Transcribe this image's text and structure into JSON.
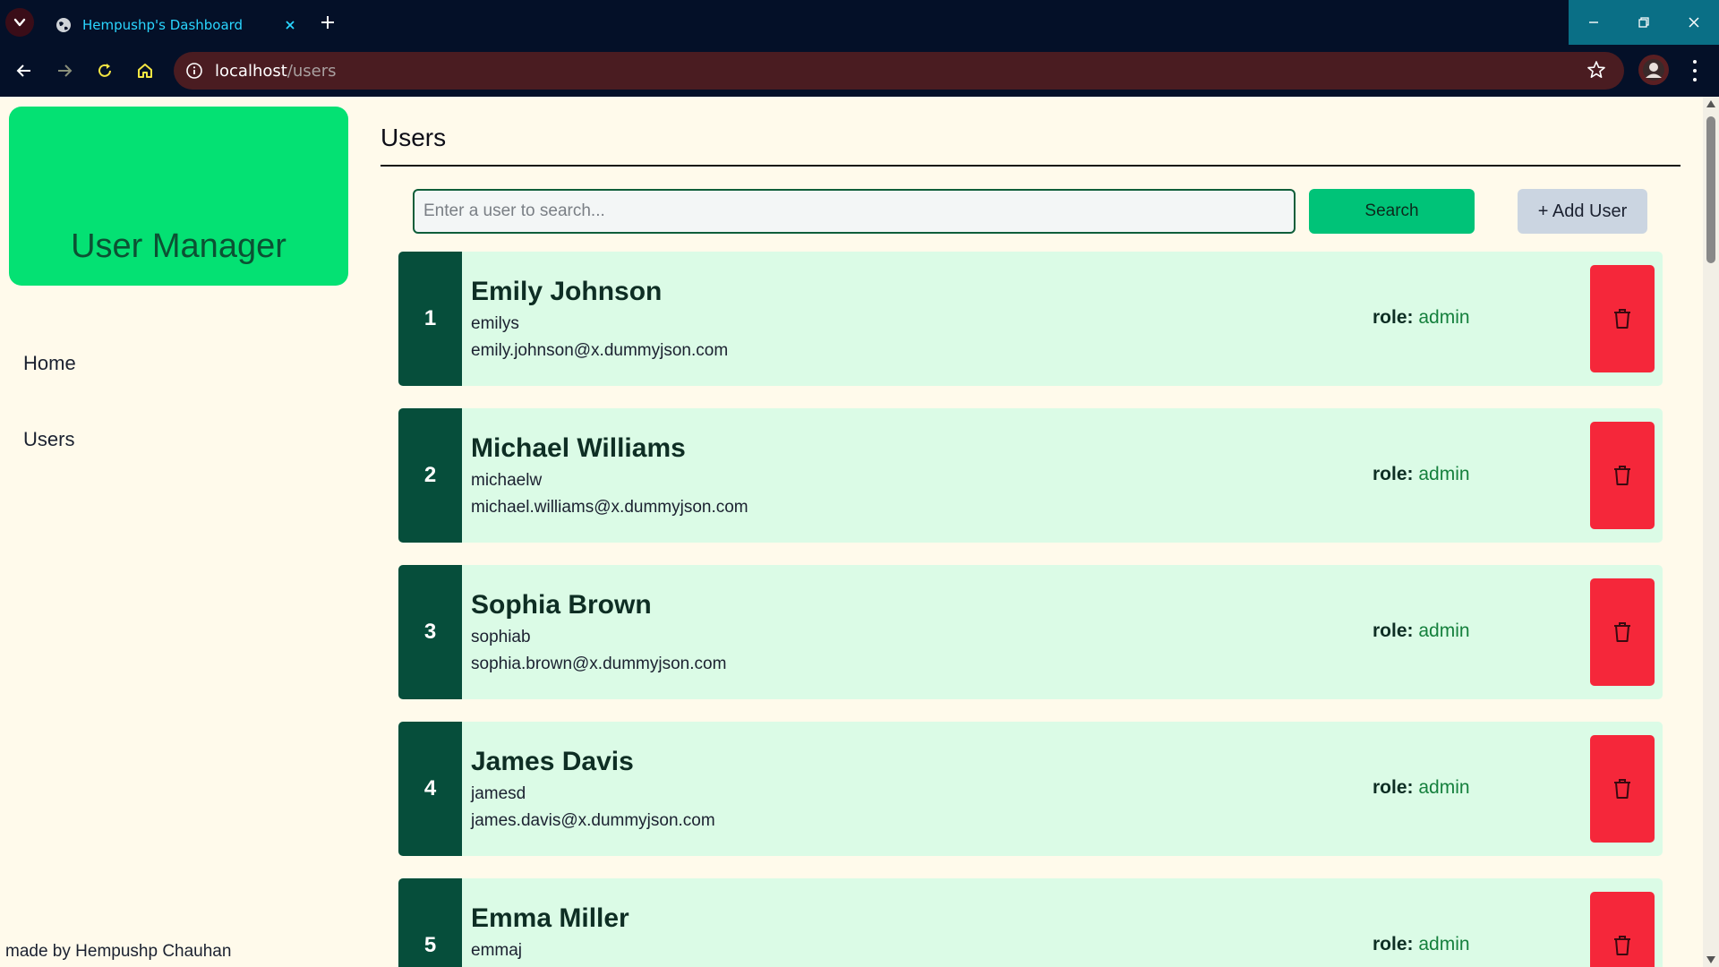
{
  "browser": {
    "tab_title": "Hempushp's Dashboard",
    "url_host": "localhost",
    "url_path": "/users"
  },
  "sidebar": {
    "brand": "User Manager",
    "nav": [
      {
        "label": "Home"
      },
      {
        "label": "Users"
      }
    ],
    "credit": "made by Hempushp Chauhan"
  },
  "main": {
    "title": "Users",
    "search_placeholder": "Enter a user to search...",
    "search_button": "Search",
    "add_button": "+ Add User",
    "role_label": "role:"
  },
  "users": [
    {
      "index": "1",
      "name": "Emily Johnson",
      "username": "emilys",
      "email": "emily.johnson@x.dummyjson.com",
      "role": "admin"
    },
    {
      "index": "2",
      "name": "Michael Williams",
      "username": "michaelw",
      "email": "michael.williams@x.dummyjson.com",
      "role": "admin"
    },
    {
      "index": "3",
      "name": "Sophia Brown",
      "username": "sophiab",
      "email": "sophia.brown@x.dummyjson.com",
      "role": "admin"
    },
    {
      "index": "4",
      "name": "James Davis",
      "username": "jamesd",
      "email": "james.davis@x.dummyjson.com",
      "role": "admin"
    },
    {
      "index": "5",
      "name": "Emma Miller",
      "username": "emmaj",
      "email": "",
      "role": "admin"
    }
  ]
}
